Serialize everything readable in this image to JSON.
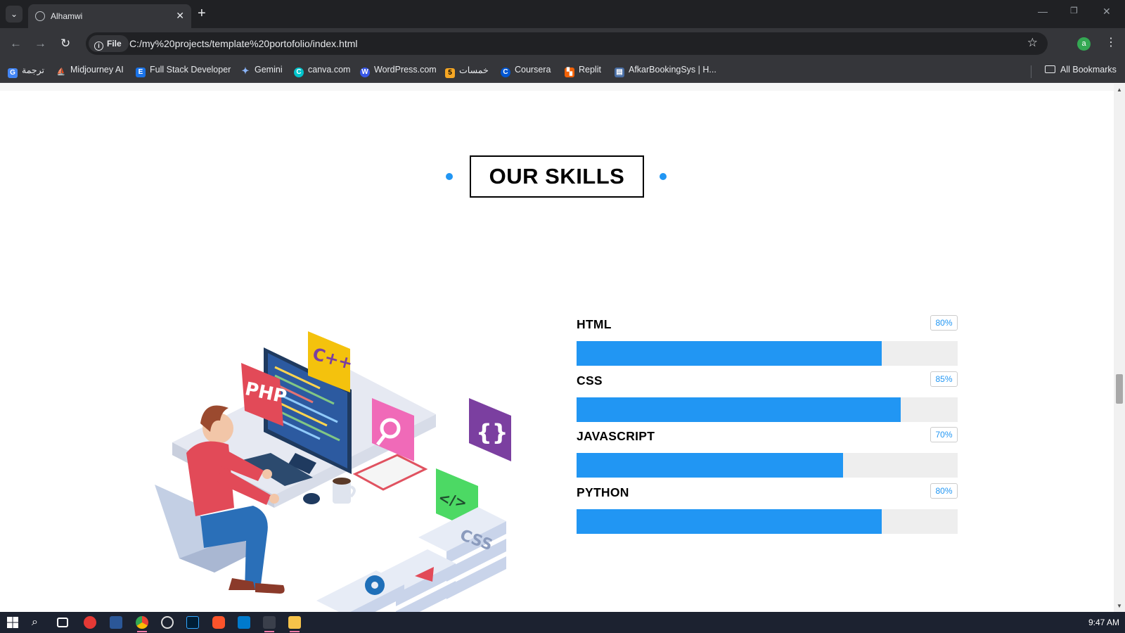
{
  "browser": {
    "tab_title": "Alhamwi",
    "tab_close": "✕",
    "new_tab": "+",
    "site_chip": "File",
    "url": "C:/my%20projects/template%20portofolio/index.html",
    "profile_initial": "a",
    "bookmarks": [
      {
        "label": "ترجمة",
        "icon": "google-translate-icon",
        "color": "#4285f4"
      },
      {
        "label": "Midjourney AI",
        "icon": "midjourney-icon",
        "color": "#ffffff"
      },
      {
        "label": "Full Stack Developer",
        "icon": "e-icon",
        "color": "#1a73e8"
      },
      {
        "label": "Gemini",
        "icon": "gemini-sparkle-icon",
        "color": "#8ab4f8"
      },
      {
        "label": "canva.com",
        "icon": "canva-icon",
        "color": "#00c4cc"
      },
      {
        "label": "WordPress.com",
        "icon": "wordpress-icon",
        "color": "#3858e9"
      },
      {
        "label": "خمسات",
        "icon": "khamsat-icon",
        "color": "#f5a623"
      },
      {
        "label": "Coursera",
        "icon": "coursera-icon",
        "color": "#0056d2"
      },
      {
        "label": "Replit",
        "icon": "replit-icon",
        "color": "#f26207"
      },
      {
        "label": "AfkarBookingSys | H...",
        "icon": "afkar-icon",
        "color": "#4a6fa5"
      }
    ],
    "all_bookmarks": "All Bookmarks"
  },
  "page": {
    "section_title": "OUR SKILLS",
    "accent_color": "#2196f3",
    "skills": [
      {
        "name": "HTML",
        "percent_label": "80%",
        "value": 80
      },
      {
        "name": "CSS",
        "percent_label": "85%",
        "value": 85
      },
      {
        "name": "JAVASCRIPT",
        "percent_label": "70%",
        "value": 70
      },
      {
        "name": "PYTHON",
        "percent_label": "80%",
        "value": 80
      }
    ],
    "illustration_badges": {
      "php": "PHP",
      "cpp": "C++",
      "code": "</>",
      "braces": "{}",
      "css": "CSS"
    }
  },
  "taskbar": {
    "clock": "9:47 AM"
  }
}
